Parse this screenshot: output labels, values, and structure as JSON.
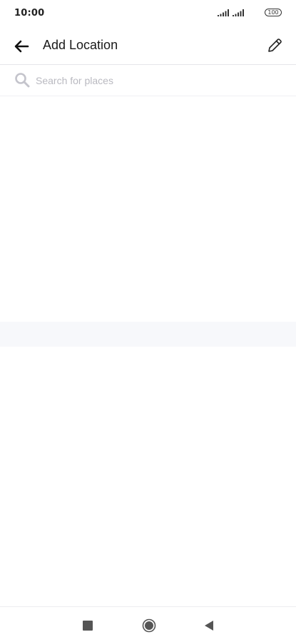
{
  "status_bar": {
    "time": "10:00",
    "battery": "100",
    "icons": [
      "signal-icon",
      "signal-icon",
      "battery-icon"
    ]
  },
  "app_bar": {
    "title": "Add Location",
    "back_icon": "back-arrow-icon",
    "edit_icon": "pencil-icon"
  },
  "search": {
    "placeholder": "Search for places",
    "value": "",
    "icon": "search-icon"
  },
  "nav_bar": {
    "icons": [
      "recents-square-icon",
      "home-circle-icon",
      "back-triangle-icon"
    ]
  },
  "colors": {
    "text_primary": "#1a1a1a",
    "placeholder": "#b9b9c0",
    "divider": "#e6e6ea",
    "band": "#f7f8fb",
    "icon_gray": "#c4c4cc"
  }
}
